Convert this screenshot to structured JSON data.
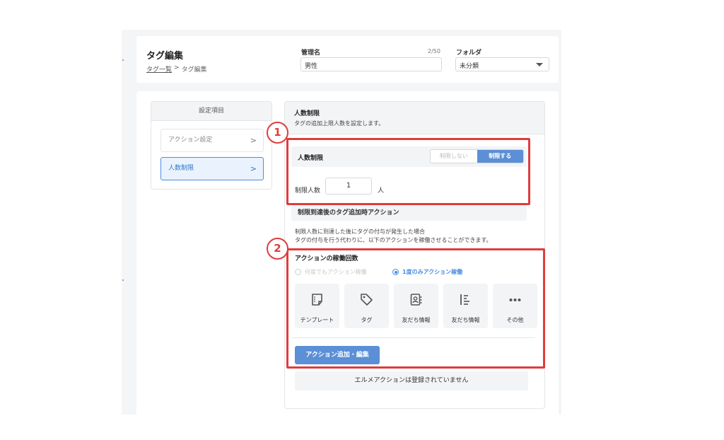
{
  "header": {
    "title": "タグ編集",
    "breadcrumb": {
      "parent": "タグ一覧",
      "separator": ">",
      "current": "タグ編集"
    },
    "name_field": {
      "label": "管理名",
      "counter": "2/50",
      "value": "男性"
    },
    "folder_field": {
      "label": "フォルダ",
      "value": "未分類"
    }
  },
  "settings": {
    "heading": "設定項目",
    "items": [
      {
        "label": "アクション設定",
        "chevron": ">"
      },
      {
        "label": "人数制限",
        "chevron": ">"
      }
    ]
  },
  "content": {
    "title": "人数制限",
    "description": "タグの追加上限人数を設定します。",
    "limit_toggle": {
      "label": "人数制限",
      "off": "制限しない",
      "on": "制限する"
    },
    "limit_count": {
      "label": "制限人数",
      "value": "1",
      "unit": "人"
    },
    "after_limit": {
      "heading": "制限到達後のタグ追加時アクション",
      "description_line1": "制限人数に到達した後にタグの付与が発生した場合",
      "description_line2": "タグの付与を行う代わりに、以下のアクションを稼働させることができます。"
    },
    "action_count": {
      "title": "アクションの稼働回数",
      "option_every": "何度でもアクション稼働",
      "option_once": "1度のみアクション稼働"
    },
    "tiles": [
      {
        "label": "テンプレート",
        "icon": "template-icon"
      },
      {
        "label": "タグ",
        "icon": "tag-icon"
      },
      {
        "label": "友だち情報",
        "icon": "contact-card-icon"
      },
      {
        "label": "友だち情報",
        "icon": "list-indent-icon"
      },
      {
        "label": "その他",
        "icon": "more-dots-icon"
      }
    ],
    "add_button": "アクション追加・編集",
    "empty_message": "エルメアクションは登録されていません"
  },
  "callouts": [
    "1",
    "2"
  ],
  "colors": {
    "accent": "#5b8fd6",
    "callout": "#e03c3c",
    "active_item_bg": "#eaf2fd"
  }
}
